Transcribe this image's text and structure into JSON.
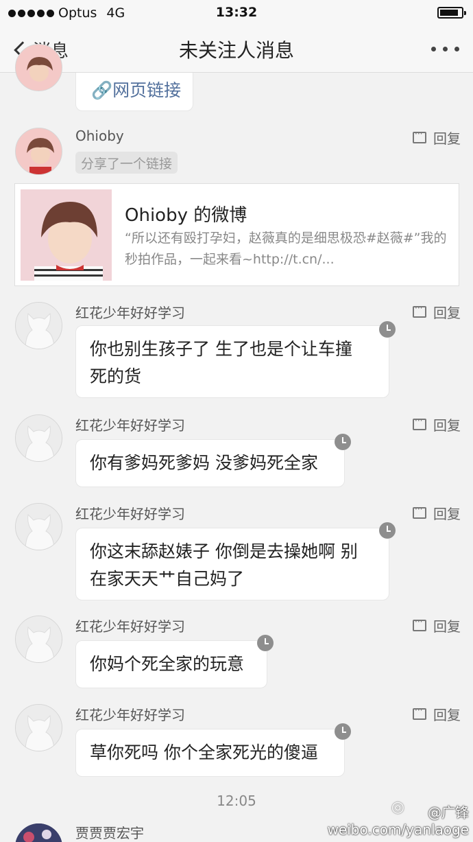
{
  "status_bar": {
    "carrier": "Optus",
    "network": "4G",
    "time": "13:32"
  },
  "nav": {
    "back_label": "消息",
    "title": "未关注人消息"
  },
  "first_message": {
    "link_label": "🔗网页链接"
  },
  "ohioby": {
    "sender": "Ohioby",
    "reply_label": "回复",
    "share_tag": "分享了一个链接",
    "card_title": "Ohioby 的微博",
    "card_desc": "“所以还有殴打孕妇，赵薇真的是细思极恐#赵薇#”我的秒拍作品，一起来看~http://t.cn/..."
  },
  "messages": [
    {
      "sender": "红花少年好好学习",
      "reply_label": "回复",
      "text_lines": [
        "你也别生孩子了 生了也是个让车撞",
        "死的货"
      ]
    },
    {
      "sender": "红花少年好好学习",
      "reply_label": "回复",
      "text_lines": [
        "你有爹妈死爹妈 没爹妈死全家"
      ]
    },
    {
      "sender": "红花少年好好学习",
      "reply_label": "回复",
      "text_lines": [
        "你这末舔赵婊子 你倒是去操她啊 别",
        "在家天天艹自己妈了"
      ]
    },
    {
      "sender": "红花少年好好学习",
      "reply_label": "回复",
      "text_lines": [
        "你妈个死全家的玩意"
      ]
    },
    {
      "sender": "红花少年好好学习",
      "reply_label": "回复",
      "text_lines": [
        "草你死吗 你个全家死光的傻逼"
      ]
    }
  ],
  "timestamp": "12:05",
  "last_sender": "贾贾贾宏宇",
  "watermark": {
    "handle": "@广锋",
    "url": "weibo.com/yanlaoge"
  },
  "colors": {
    "background": "#f2f2f2",
    "link": "#52709c",
    "clock": "#8e8e8e"
  }
}
